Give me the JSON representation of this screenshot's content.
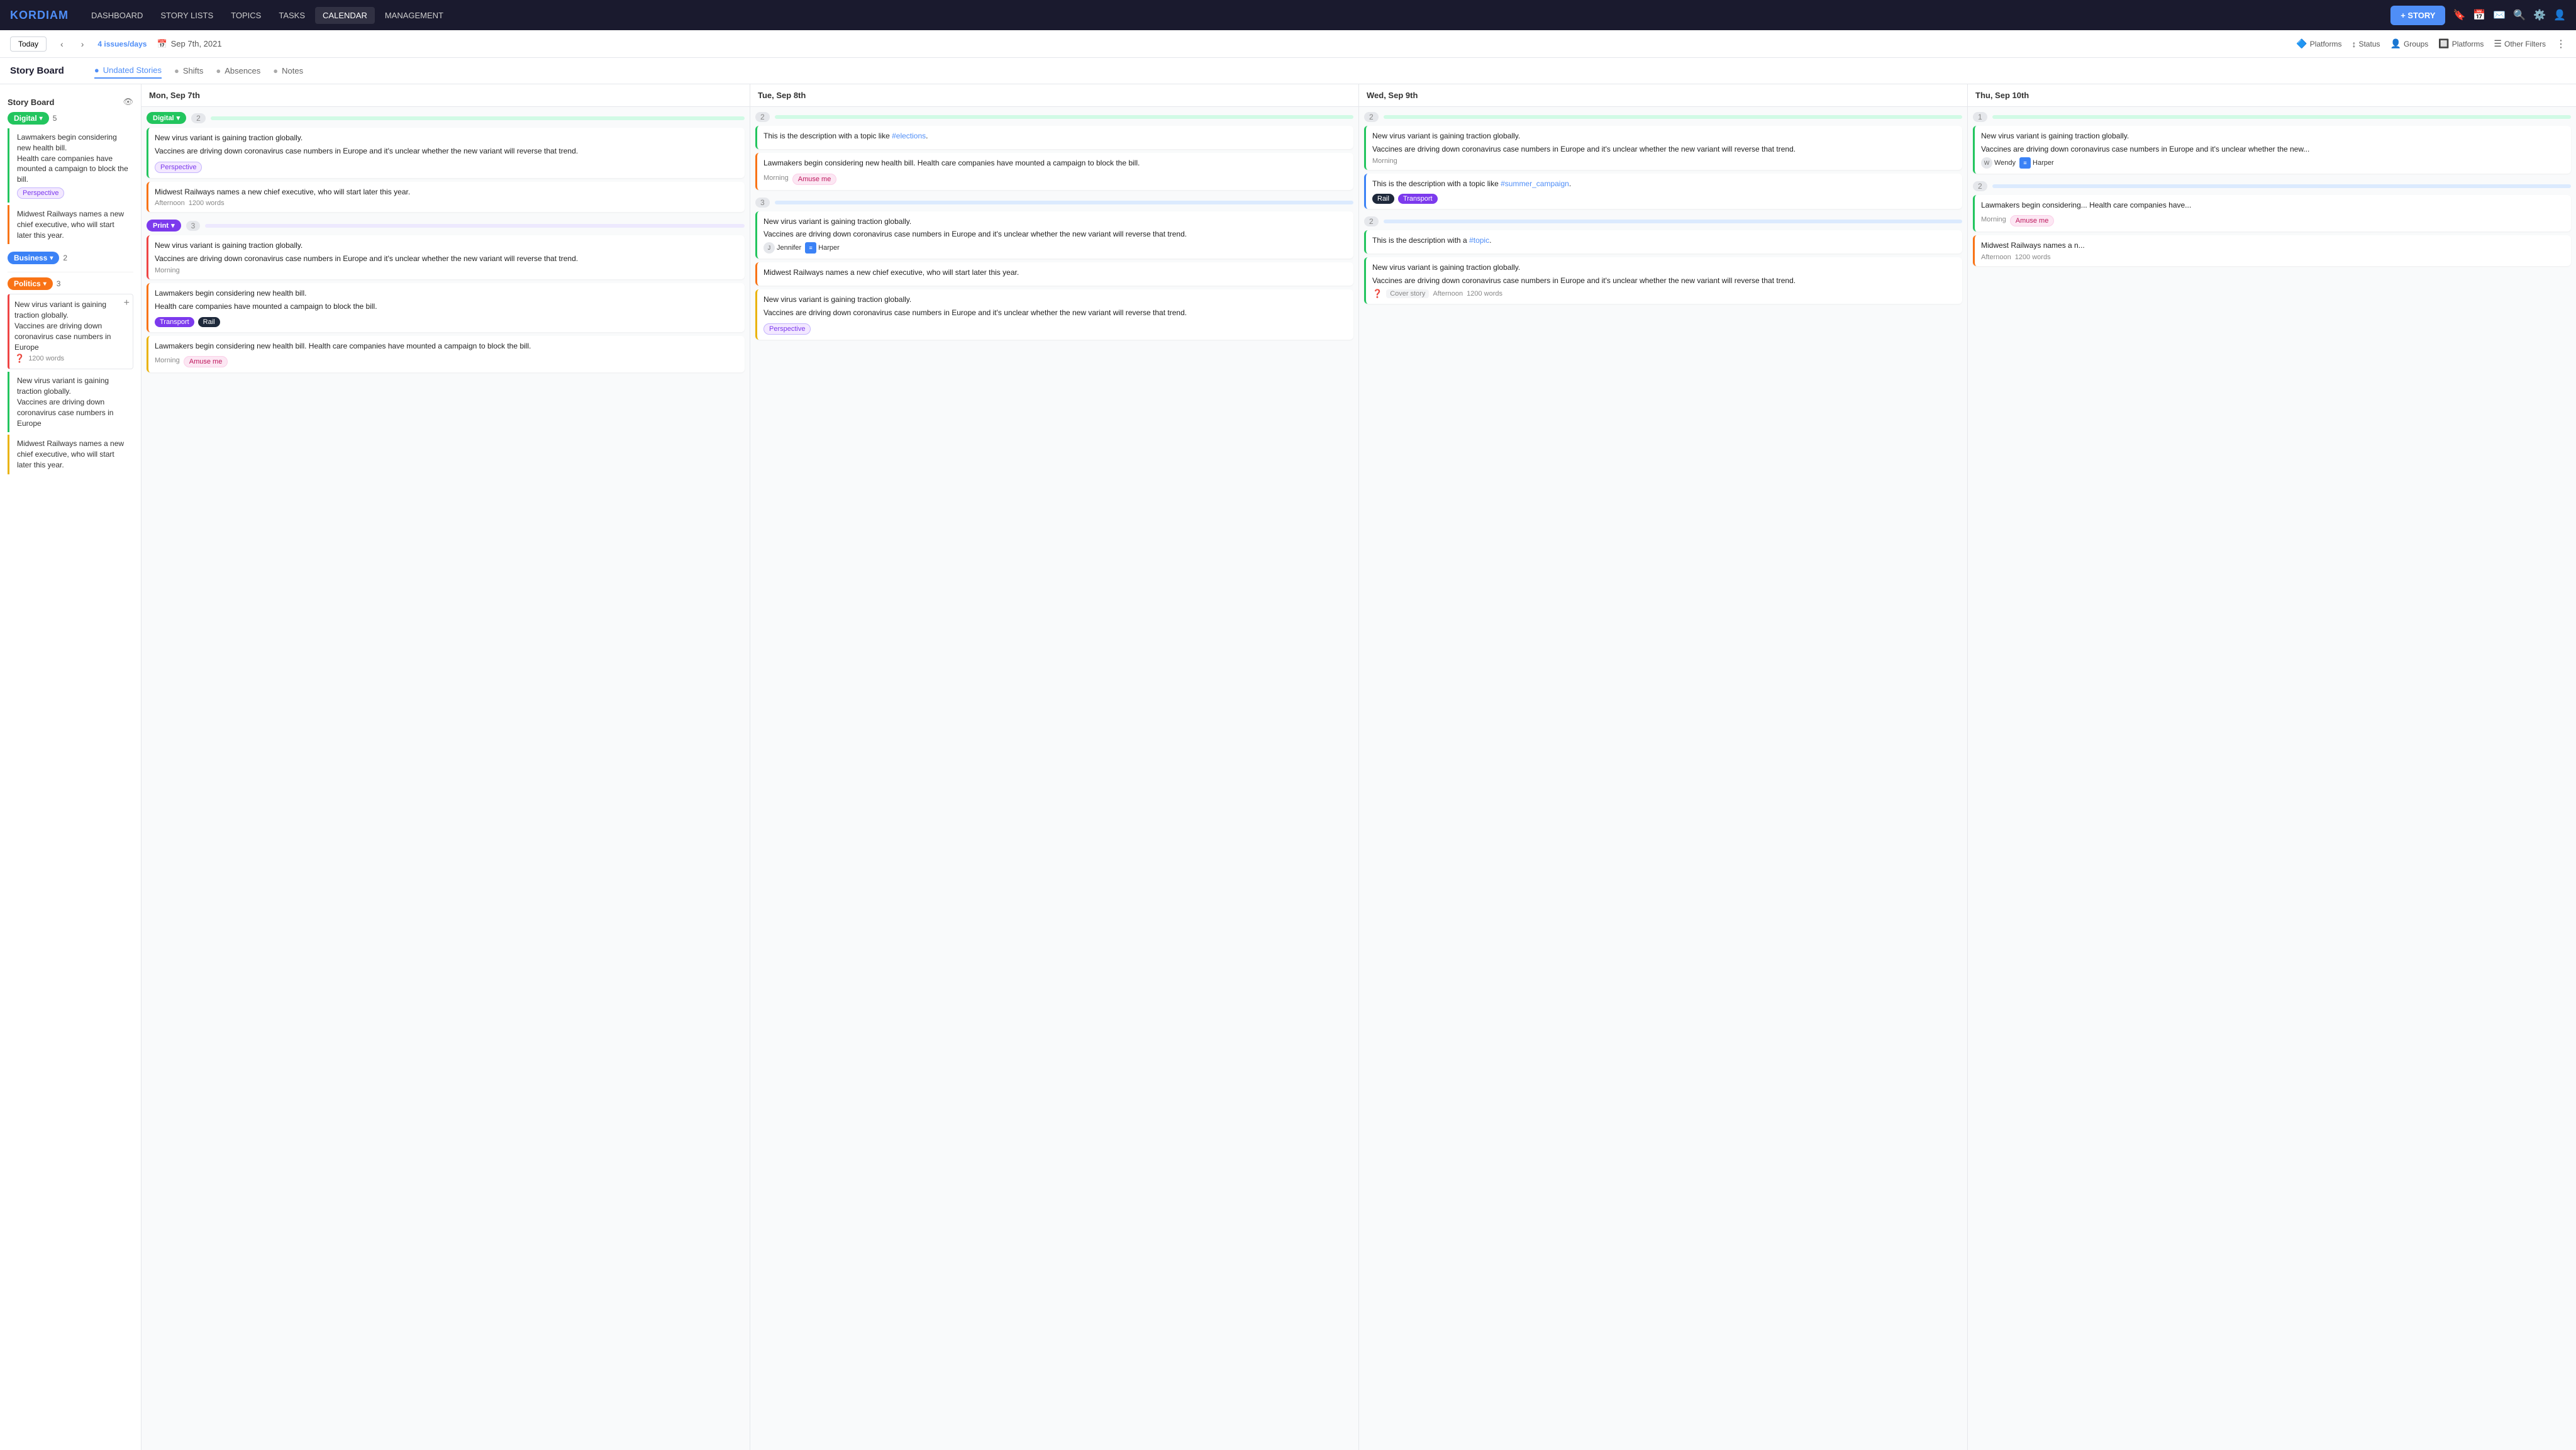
{
  "app": {
    "logo": "KORDIAM",
    "nav_items": [
      "DASHBOARD",
      "STORY LISTS",
      "TOPICS",
      "TASKS",
      "CALENDAR",
      "MANAGEMENT"
    ],
    "active_nav": "CALENDAR",
    "story_btn": "+ STORY"
  },
  "sub_nav": {
    "today_label": "Today",
    "issues_label": "4 issues/days",
    "date": "Sep 7th, 2021",
    "calendar_icon": "📅",
    "filters": [
      {
        "label": "Platforms",
        "icon": "🔷"
      },
      {
        "label": "Status",
        "icon": "↕"
      },
      {
        "label": "Groups",
        "icon": "👤"
      },
      {
        "label": "Platforms",
        "icon": "🔲"
      },
      {
        "label": "Other Filters",
        "icon": "☰"
      }
    ],
    "more_icon": "⋮"
  },
  "board": {
    "title": "Story Board",
    "tabs": [
      {
        "label": "Undated Stories",
        "active": true,
        "dot_color": "#4f8ef7"
      },
      {
        "label": "Shifts",
        "active": false,
        "dot_color": "#aaa"
      },
      {
        "label": "Absences",
        "active": false,
        "dot_color": "#aaa"
      },
      {
        "label": "Notes",
        "active": false,
        "dot_color": "#aaa"
      }
    ]
  },
  "sidebar": {
    "title": "Undated Stories",
    "platforms": [
      {
        "name": "Digital",
        "color": "#22c55e",
        "count": 5,
        "stories": [
          {
            "text": "Lawmakers begin considering new health bill.",
            "text2": "Health care companies have mounted a campaign to block the bill.",
            "color": "green",
            "tag": "Perspective",
            "tag_class": "tag-perspective"
          },
          {
            "text": "Midwest Railways names a new chief executive, who will start later this year.",
            "color": "orange",
            "tag": null
          }
        ]
      },
      {
        "name": "Business",
        "color": "#3b82f6",
        "count": 2,
        "stories": []
      },
      {
        "name": "Politics",
        "color": "#f97316",
        "count": 3,
        "stories": [
          {
            "text": "New virus variant is gaining traction globally.",
            "text2": "Vaccines are driving down coronavirus case numbers in Europe",
            "color": "red",
            "words": "1200 words",
            "has_question": true
          },
          {
            "text": "New virus variant is gaining traction globally.",
            "text2": "Vaccines are driving down coronavirus case numbers in Europe",
            "color": "green"
          },
          {
            "text": "Midwest Railways names a new chief executive, who will start later this year.",
            "color": "yellow"
          }
        ]
      }
    ]
  },
  "calendar": {
    "days": [
      {
        "label": "Mon, Sep 7th",
        "platforms": [
          {
            "name": "Digital",
            "color": "#22c55e",
            "count": 2,
            "bar_color": "green",
            "stories": [
              {
                "color": "green",
                "title": "New virus variant is gaining traction globally.",
                "subtitle": "Vaccines are driving down coronavirus case numbers in Europe and it's unclear whether the new variant will reverse that trend.",
                "tag": "Perspective",
                "tag_class": "tag-perspective"
              },
              {
                "color": "orange",
                "title": "Midwest Railways names a new chief executive, who will start later this year.",
                "meta": "Afternoon",
                "words": "1200 words"
              }
            ]
          },
          {
            "name": "Print",
            "color": "#7c3aed",
            "count": 3,
            "bar_color": "purple",
            "stories": [
              {
                "color": "green",
                "title": "New virus variant is gaining traction globally.",
                "subtitle": "Vaccines are driving down coronavirus case numbers in Europe and it's unclear whether the new variant will reverse that trend.",
                "meta": "Morning"
              },
              {
                "color": "orange",
                "title": "Lawmakers begin considering new health bill.",
                "subtitle": "Health care companies have mounted a campaign to block the bill.",
                "tags": [
                  "Transport",
                  "Rail"
                ]
              },
              {
                "color": "yellow",
                "title": "Lawmakers begin considering new health bill. Health care companies have mounted a campaign to block the bill.",
                "meta": "Morning",
                "tag": "Amuse me",
                "tag_class": "tag-amuse"
              }
            ]
          }
        ]
      },
      {
        "label": "Tue, Sep 8th",
        "platforms": [
          {
            "name": null,
            "color": null,
            "count": 2,
            "bar_color": "green",
            "stories": [
              {
                "color": "green",
                "title": "This is the description with a topic like #elections.",
                "has_link": true,
                "link_text": "#elections"
              },
              {
                "color": "orange",
                "title": "Lawmakers begin considering new health bill. Health care companies have mounted a campaign to block the bill.",
                "meta": "Morning",
                "tag": "Amuse me",
                "tag_class": "tag-amuse"
              }
            ]
          },
          {
            "name": null,
            "color": null,
            "count": 3,
            "bar_color": "blue",
            "stories": [
              {
                "color": "green",
                "title": "New virus variant is gaining traction globally.",
                "subtitle": "Vaccines are driving down coronavirus case numbers in Europe and it's unclear whether the new variant will reverse that trend.",
                "avatars": [
                  "Jennifer",
                  "Harper"
                ]
              },
              {
                "color": "orange",
                "title": "Midwest Railways names a new chief executive, who will start later this year."
              },
              {
                "color": "yellow",
                "title": "New virus variant is gaining traction globally.",
                "subtitle": "Vaccines are driving down coronavirus case numbers in Europe and it's unclear whether the new variant will reverse that trend.",
                "tag": "Perspective",
                "tag_class": "tag-perspective"
              }
            ]
          }
        ]
      },
      {
        "label": "Wed, Sep 9th",
        "platforms": [
          {
            "name": null,
            "color": null,
            "count": 2,
            "bar_color": "green",
            "stories": [
              {
                "color": "green",
                "title": "New virus variant is gaining traction globally.",
                "subtitle": "Vaccines are driving down coronavirus case numbers in Europe and it's unclear whether the new variant will reverse that trend.",
                "meta": "Morning"
              },
              {
                "color": "blue",
                "title": "This is the description with a topic like #summer_campaign.",
                "has_link": true,
                "link_text": "#summer_campaign",
                "tags": [
                  "Rail",
                  "Transport"
                ]
              }
            ]
          },
          {
            "name": null,
            "color": null,
            "count": 2,
            "bar_color": "blue",
            "stories": [
              {
                "color": "green",
                "title": "This is the description with a #topic.",
                "has_link": true,
                "link_text": "#topic"
              },
              {
                "color": "green",
                "title": "New virus variant is gaining traction globally.",
                "subtitle": "Vaccines are driving down coronavirus case numbers in Europe and it's unclear whether the new variant will reverse that trend.",
                "has_question": true,
                "meta2": "Cover story",
                "meta": "Afternoon",
                "words": "1200 words"
              }
            ]
          }
        ]
      },
      {
        "label": "Thu, Sep 10th",
        "platforms": [
          {
            "name": null,
            "color": null,
            "count": 1,
            "bar_color": "green",
            "stories": [
              {
                "color": "green",
                "title": "New virus variant is gaining traction globally.",
                "subtitle": "Vaccines are driving down coronavirus case numbers in Europe and it's unclear whether the new...",
                "avatars_right": [
                  "Wendy",
                  "Harper"
                ]
              }
            ]
          },
          {
            "name": null,
            "color": null,
            "count": 2,
            "bar_color": "blue",
            "stories": [
              {
                "color": "green",
                "title": "Lawmakers begin considering... Health care companies have...",
                "meta": "Morning",
                "tag": "Amuse me",
                "tag_class": "tag-amuse"
              },
              {
                "color": "orange",
                "title": "Midwest Railways names a n...",
                "meta": "Afternoon",
                "words": "1200 words"
              }
            ]
          }
        ]
      }
    ]
  }
}
